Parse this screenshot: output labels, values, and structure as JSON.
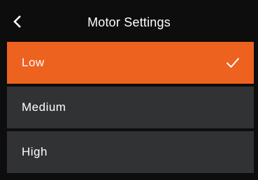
{
  "header": {
    "title": "Motor Settings",
    "back_icon": "chevron-left-icon"
  },
  "options": [
    {
      "label": "Low",
      "selected": true
    },
    {
      "label": "Medium",
      "selected": false
    },
    {
      "label": "High",
      "selected": false
    }
  ],
  "colors": {
    "background": "#0d0d0d",
    "selected": "#ee6220",
    "option": "#303233",
    "text": "#ffffff"
  }
}
